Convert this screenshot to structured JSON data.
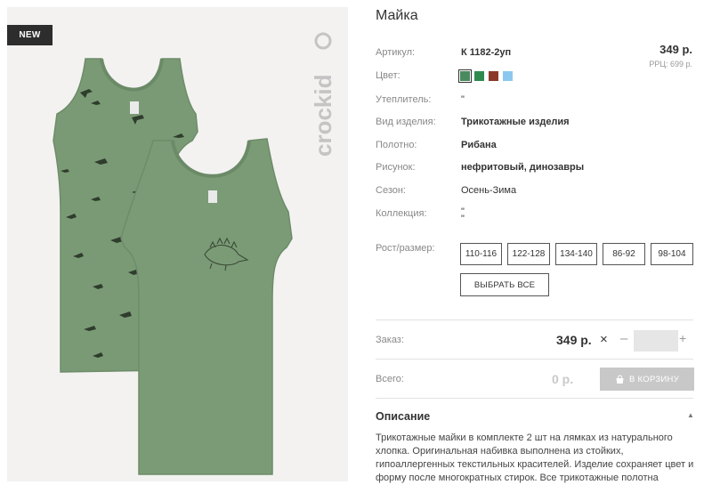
{
  "product": {
    "badge": "NEW",
    "brand": "crockid",
    "title": "Майка",
    "price": "349 р.",
    "rrp": "РРЦ: 699 р."
  },
  "specs": [
    {
      "label": "Артикул:",
      "value": "К 1182-2уп"
    },
    {
      "label": "Цвет:",
      "value": ""
    },
    {
      "label": "Утеплитель:",
      "value": "\""
    },
    {
      "label": "Вид изделия:",
      "value": "Трикотажные изделия"
    },
    {
      "label": "Полотно:",
      "value": "Рибана"
    },
    {
      "label": "Рисунок:",
      "value": "нефритовый, динозавры"
    },
    {
      "label": "Сезон:",
      "value": "Осень-Зима"
    },
    {
      "label": "Коллекция:",
      "value": "\"\n\""
    }
  ],
  "colors": [
    "#4a8a5e",
    "#2e8b50",
    "#8b3a2a",
    "#8cc8ee"
  ],
  "size": {
    "label": "Рост/размер:",
    "options": [
      "110-116",
      "122-128",
      "134-140",
      "86-92",
      "98-104"
    ],
    "select_all": "ВЫБРАТЬ ВСЕ"
  },
  "order": {
    "label": "Заказ:",
    "price": "349 р.",
    "times": "×",
    "minus": "–",
    "plus": "+",
    "quantity": ""
  },
  "total": {
    "label": "Всего:",
    "value": "0 р.",
    "cart_label": "В КОРЗИНУ"
  },
  "description": {
    "title": "Описание",
    "text": "Трикотажные майки в комплекте 2 шт на лямках из натурального хлопка. Оригинальная набивка выполнена из стойких, гипоаллергенных текстильных красителей. Изделие сохраняет цвет и форму после многократных стирок. Все трикотажные полотна"
  }
}
